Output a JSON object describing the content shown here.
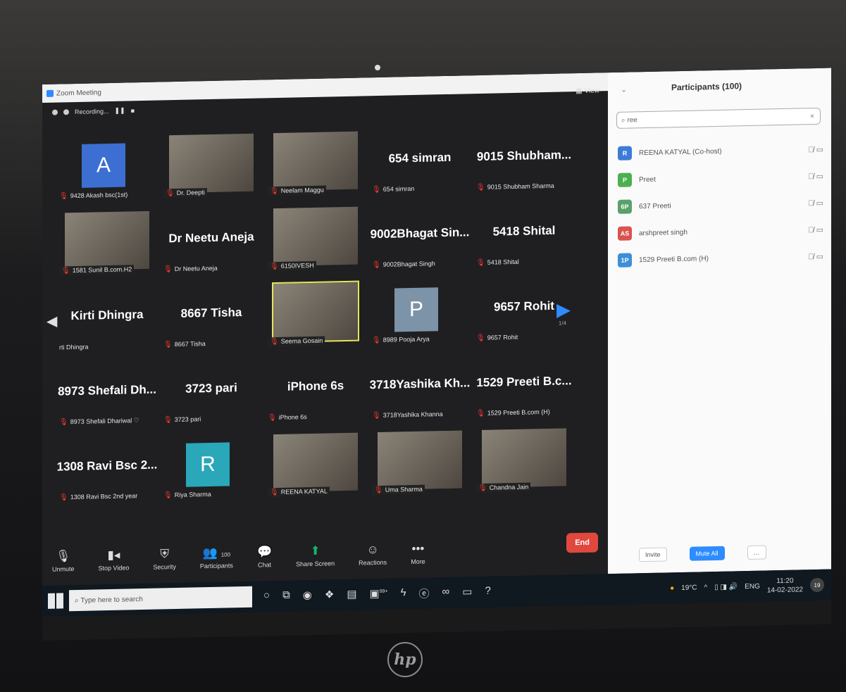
{
  "window": {
    "title": "Zoom Meeting",
    "recording": "Recording...",
    "view": "View"
  },
  "tiles": [
    {
      "name": "9428 Akash bsc(1st)",
      "avatar": "A",
      "avatar_color": "#3c6fd1"
    },
    {
      "name": "Dr. Deepti",
      "video": true
    },
    {
      "name": "Neelam Maggu",
      "video": true
    },
    {
      "big": "654 simran",
      "name": "654 simran"
    },
    {
      "big": "9015 Shubham...",
      "name": "9015 Shubham Sharma"
    },
    {
      "name": "1581 Sunil B.com.H2",
      "video": true
    },
    {
      "big": "Dr Neetu Aneja",
      "name": "Dr Neetu Aneja"
    },
    {
      "name": "6150IVESH",
      "video": true
    },
    {
      "big": "9002Bhagat Sin...",
      "name": "9002Bhagat Singh"
    },
    {
      "big": "5418 Shital",
      "name": "5418 Shital"
    },
    {
      "big": "Kirti Dhingra",
      "name": "rti Dhingra"
    },
    {
      "big": "8667 Tisha",
      "name": "8667 Tisha"
    },
    {
      "name": "Seema Gosain",
      "video": true,
      "selected": true
    },
    {
      "name": "8989 Pooja Arya",
      "avatar": "P",
      "avatar_color": "#7c93a8"
    },
    {
      "big": "9657 Rohit",
      "name": "9657 Rohit"
    },
    {
      "big": "8973 Shefali Dh...",
      "name": "8973 Shefali Dhariwal ♡"
    },
    {
      "big": "3723 pari",
      "name": "3723 pari"
    },
    {
      "big": "iPhone 6s",
      "name": "iPhone 6s"
    },
    {
      "big": "3718Yashika Kh...",
      "name": "3718Yashika Khanna"
    },
    {
      "big": "1529 Preeti B.c...",
      "name": "1529 Preeti B.com (H)"
    },
    {
      "big": "1308 Ravi Bsc 2...",
      "name": "1308 Ravi Bsc 2nd year"
    },
    {
      "name": "Riya Sharma",
      "avatar": "R",
      "avatar_color": "#2aa7b8"
    },
    {
      "name": "REENA KATYAL",
      "video": true
    },
    {
      "name": "Uma Sharma",
      "video": true
    },
    {
      "name": "Chandna Jain",
      "video": true
    }
  ],
  "pager": "1/4",
  "toolbar": {
    "unmute": "Unmute",
    "stop_video": "Stop Video",
    "security": "Security",
    "participants": "Participants",
    "participants_count": "100",
    "chat": "Chat",
    "share_screen": "Share Screen",
    "reactions": "Reactions",
    "more": "More",
    "end": "End"
  },
  "panel": {
    "title": "Participants (100)",
    "search_value": "ree",
    "participants": [
      {
        "initials": "R",
        "name": "REENA KATYAL (Co-host)",
        "color": "#3d7bd8"
      },
      {
        "initials": "P",
        "name": "Preet",
        "color": "#4caf50"
      },
      {
        "initials": "6P",
        "name": "637 Preeti",
        "color": "#5aa06a"
      },
      {
        "initials": "AS",
        "name": "arshpreet singh",
        "color": "#d9534f"
      },
      {
        "initials": "1P",
        "name": "1529 Preeti B.com (H)",
        "color": "#3d8fd8"
      }
    ],
    "invite": "Invite",
    "mute_all": "Mute All"
  },
  "taskbar": {
    "search_placeholder": "Type here to search",
    "badge": "99+",
    "weather": "19°C",
    "language": "ENG",
    "time": "11:20",
    "date": "14-02-2022",
    "notifications": "19"
  },
  "brand": "hp"
}
